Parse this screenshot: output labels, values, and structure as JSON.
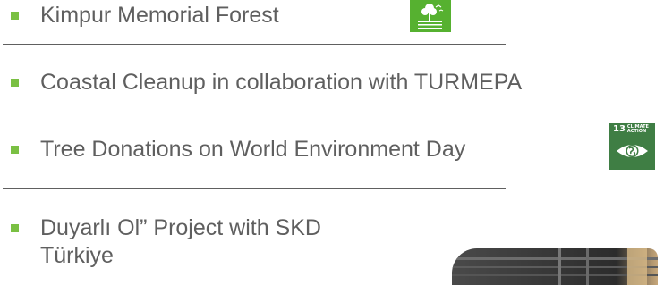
{
  "items": [
    {
      "label": "Kimpur Memorial Forest"
    },
    {
      "label": "Coastal Cleanup in collaboration with TURMEPA"
    },
    {
      "label": "Tree Donations on World Environment Day"
    },
    {
      "label": "Duyarlı Ol” Project with SKD Türkiye"
    }
  ],
  "sdg13": {
    "number": "13",
    "text_line1": "CLIMATE",
    "text_line2": "ACTION"
  },
  "colors": {
    "bullet": "#7ac043",
    "text": "#5f5f5f",
    "sdg15_green": "#56b130",
    "sdg13_green": "#3f7e44"
  },
  "icons": [
    "sdg15-life-on-land-icon",
    "sdg13-climate-action-icon",
    "photo-thumbnail"
  ]
}
